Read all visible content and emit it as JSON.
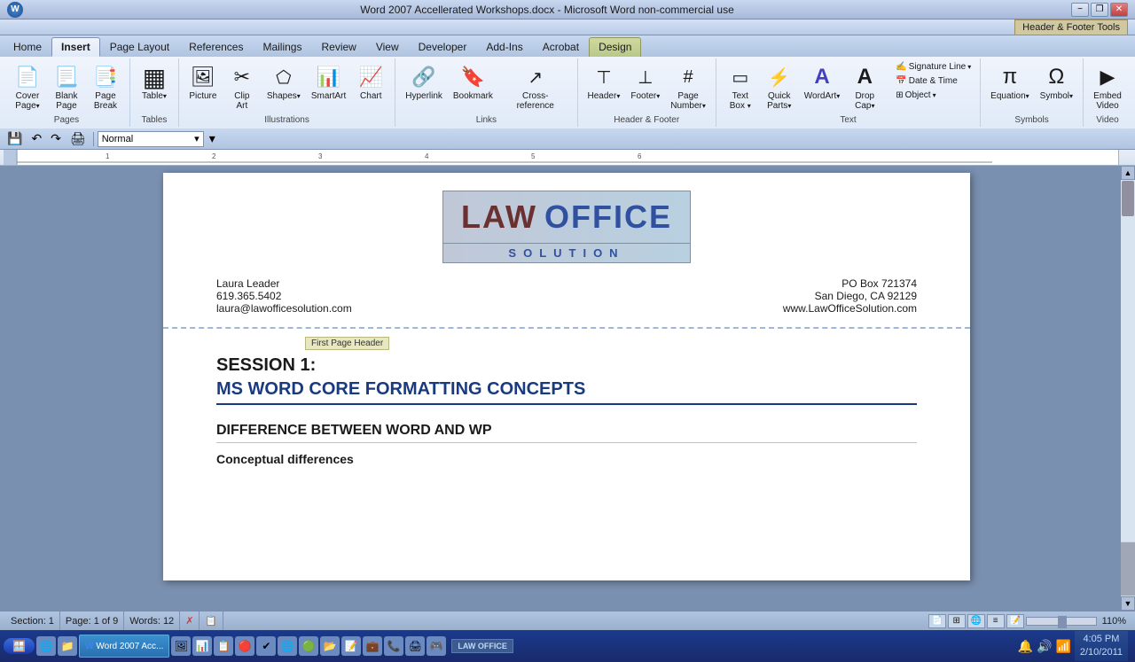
{
  "window": {
    "title": "Word 2007 Accellerated Workshops.docx - Microsoft Word non-commercial use",
    "header_tools": "Header & Footer Tools",
    "min": "−",
    "restore": "❐",
    "close": "✕"
  },
  "ribbon": {
    "tabs": [
      "Home",
      "Insert",
      "Page Layout",
      "References",
      "Mailings",
      "Review",
      "View",
      "Developer",
      "Add-Ins",
      "Acrobat",
      "Design"
    ],
    "active_tab": "Insert",
    "design_tab": "Design",
    "groups": {
      "pages": {
        "label": "Pages",
        "buttons": [
          "Cover Page",
          "Blank Page",
          "Page Break"
        ]
      },
      "tables": {
        "label": "Tables",
        "buttons": [
          "Table"
        ]
      },
      "illustrations": {
        "label": "Illustrations",
        "buttons": [
          "Picture",
          "Clip Art",
          "Shapes",
          "SmartArt",
          "Chart"
        ]
      },
      "links": {
        "label": "Links",
        "buttons": [
          "Hyperlink",
          "Bookmark",
          "Cross-reference"
        ]
      },
      "header_footer": {
        "label": "Header & Footer",
        "buttons": [
          "Header",
          "Footer",
          "Page Number"
        ]
      },
      "text": {
        "label": "Text",
        "right_items": [
          "Signature Line",
          "Date & Time",
          "Object"
        ],
        "buttons": [
          "Text Box",
          "Quick Parts",
          "WordArt",
          "Drop Cap"
        ]
      },
      "symbols": {
        "label": "Symbols",
        "buttons": [
          "Equation",
          "Symbol"
        ]
      },
      "video": {
        "label": "Video",
        "buttons": [
          "Embed Video"
        ]
      }
    }
  },
  "quick_access": {
    "style_value": "Normal"
  },
  "document": {
    "header": {
      "company": "LAW OFFICE",
      "tagline": "SOLUTION",
      "name": "Laura Leader",
      "phone": "619.365.5402",
      "email": "laura@lawofficesolution.com",
      "address": "PO Box 721374",
      "city_state": "San Diego, CA 92129",
      "website": "www.LawOfficeSolution.com"
    },
    "first_page_label": "First Page Header",
    "body": {
      "session_title": "SESSION 1:",
      "session_subtitle": "MS WORD CORE FORMATTING CONCEPTS",
      "section1_heading": "DIFFERENCE BETWEEN WORD AND WP",
      "subsection1": "Conceptual differences"
    }
  },
  "status_bar": {
    "section": "Section: 1",
    "page": "Page: 1 of 9",
    "words": "Words: 12",
    "zoom": "110%"
  },
  "taskbar": {
    "start": "Start",
    "time": "4:05 PM",
    "date": "2/10/2011",
    "apps": [
      {
        "icon": "🪟",
        "label": ""
      },
      {
        "icon": "🦊",
        "label": ""
      },
      {
        "icon": "📁",
        "label": ""
      },
      {
        "icon": "W",
        "label": "Word 2007 Acc...",
        "active": true
      },
      {
        "icon": "🖼",
        "label": ""
      },
      {
        "icon": "📊",
        "label": ""
      },
      {
        "icon": "📋",
        "label": ""
      },
      {
        "icon": "🔴",
        "label": ""
      },
      {
        "icon": "📄",
        "label": ""
      },
      {
        "icon": "✔",
        "label": ""
      },
      {
        "icon": "🌐",
        "label": ""
      },
      {
        "icon": "🟢",
        "label": ""
      },
      {
        "icon": "📂",
        "label": ""
      },
      {
        "icon": "📝",
        "label": ""
      },
      {
        "icon": "💼",
        "label": ""
      },
      {
        "icon": "📞",
        "label": ""
      },
      {
        "icon": "🖨",
        "label": ""
      },
      {
        "icon": "📊",
        "label": ""
      },
      {
        "icon": "🎮",
        "label": ""
      }
    ]
  },
  "icons": {
    "cover_page": "📄",
    "blank_page": "📃",
    "page_break": "⬛",
    "table": "▦",
    "picture": "🖼",
    "clip_art": "✂",
    "shapes": "⬠",
    "smart_art": "📊",
    "chart": "📈",
    "hyperlink": "🔗",
    "bookmark": "🔖",
    "cross_reference": "↗",
    "header": "⊤",
    "footer": "⊥",
    "page_number": "#",
    "text_box": "▭",
    "quick_parts": "⚡",
    "word_art": "A",
    "drop_cap": "A",
    "equation": "π",
    "symbol": "Ω",
    "embed_video": "▶",
    "signature": "✍",
    "datetime": "📅",
    "object": "⊞"
  }
}
